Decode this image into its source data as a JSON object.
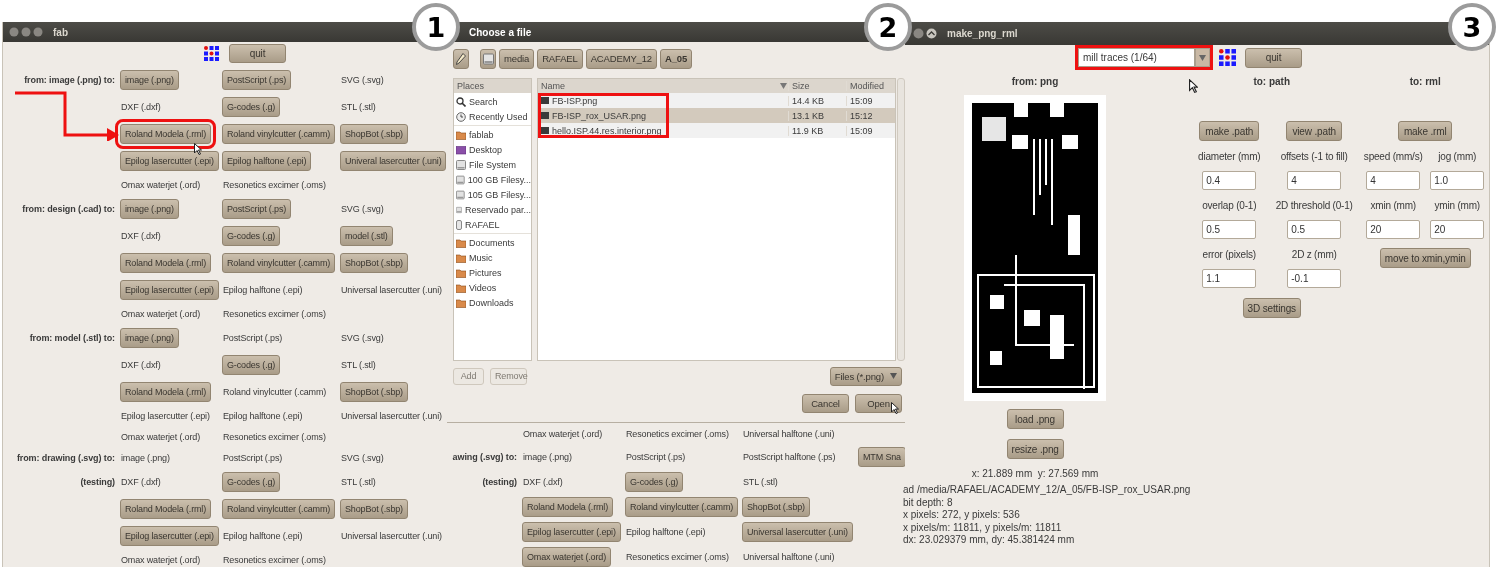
{
  "badges": [
    "1",
    "2",
    "3"
  ],
  "fab_window": {
    "title": "fab",
    "quit": "quit",
    "rows": [
      {
        "label": "from: image (.png) to:",
        "cells": [
          {
            "text": "image (.png)",
            "kind": "button"
          },
          {
            "text": "PostScript (.ps)",
            "kind": "button"
          },
          {
            "text": "SVG (.svg)",
            "kind": "label"
          }
        ]
      },
      {
        "cells": [
          {
            "text": "DXF (.dxf)",
            "kind": "label"
          },
          {
            "text": "G-codes (.g)",
            "kind": "button"
          },
          {
            "text": "STL (.stl)",
            "kind": "label"
          }
        ]
      },
      {
        "cells": [
          {
            "text": "Roland Modela (.rml)",
            "kind": "button",
            "highlighted": true
          },
          {
            "text": "Roland vinylcutter (.camm)",
            "kind": "button"
          },
          {
            "text": "ShopBot (.sbp)",
            "kind": "button"
          }
        ]
      },
      {
        "cells": [
          {
            "text": "Epilog lasercutter (.epi)",
            "kind": "button"
          },
          {
            "text": "Epilog halftone (.epi)",
            "kind": "button"
          },
          {
            "text": "Univeral lasercutter (.uni)",
            "kind": "button"
          }
        ]
      },
      {
        "cells": [
          {
            "text": "Omax waterjet (.ord)",
            "kind": "label"
          },
          {
            "text": "Resonetics excimer (.oms)",
            "kind": "label"
          }
        ]
      },
      {
        "label": "from: design (.cad) to:",
        "cells": [
          {
            "text": "image (.png)",
            "kind": "button"
          },
          {
            "text": "PostScript (.ps)",
            "kind": "button"
          },
          {
            "text": "SVG (.svg)",
            "kind": "label"
          }
        ]
      },
      {
        "cells": [
          {
            "text": "DXF (.dxf)",
            "kind": "label"
          },
          {
            "text": "G-codes (.g)",
            "kind": "button"
          },
          {
            "text": "model (.stl)",
            "kind": "button"
          }
        ]
      },
      {
        "cells": [
          {
            "text": "Roland Modela (.rml)",
            "kind": "button"
          },
          {
            "text": "Roland vinylcutter (.camm)",
            "kind": "button"
          },
          {
            "text": "ShopBot (.sbp)",
            "kind": "button"
          }
        ]
      },
      {
        "cells": [
          {
            "text": "Epilog lasercutter (.epi)",
            "kind": "button"
          },
          {
            "text": "Epilog halftone (.epi)",
            "kind": "label"
          },
          {
            "text": "Universal lasercutter (.uni)",
            "kind": "label"
          }
        ]
      },
      {
        "cells": [
          {
            "text": "Omax waterjet (.ord)",
            "kind": "label"
          },
          {
            "text": "Resonetics excimer (.oms)",
            "kind": "label"
          }
        ]
      },
      {
        "label": "from: model (.stl) to:",
        "cells": [
          {
            "text": "image (.png)",
            "kind": "button"
          },
          {
            "text": "PostScript (.ps)",
            "kind": "label"
          },
          {
            "text": "SVG (.svg)",
            "kind": "label"
          }
        ]
      },
      {
        "cells": [
          {
            "text": "DXF (.dxf)",
            "kind": "label"
          },
          {
            "text": "G-codes (.g)",
            "kind": "button"
          },
          {
            "text": "STL (.stl)",
            "kind": "label"
          }
        ]
      },
      {
        "cells": [
          {
            "text": "Roland Modela (.rml)",
            "kind": "button"
          },
          {
            "text": "Roland vinylcutter (.camm)",
            "kind": "label"
          },
          {
            "text": "ShopBot (.sbp)",
            "kind": "button"
          }
        ]
      },
      {
        "cells": [
          {
            "text": "Epilog lasercutter (.epi)",
            "kind": "label"
          },
          {
            "text": "Epilog halftone (.epi)",
            "kind": "label"
          },
          {
            "text": "Universal lasercutter (.uni)",
            "kind": "label"
          }
        ]
      },
      {
        "cells": [
          {
            "text": "Omax waterjet (.ord)",
            "kind": "label"
          },
          {
            "text": "Resonetics excimer (.oms)",
            "kind": "label"
          }
        ]
      },
      {
        "label": "from: drawing (.svg) to:",
        "cells": [
          {
            "text": "image (.png)",
            "kind": "label"
          },
          {
            "text": "PostScript (.ps)",
            "kind": "label"
          },
          {
            "text": "SVG (.svg)",
            "kind": "label"
          }
        ]
      },
      {
        "label": "(testing)",
        "cells": [
          {
            "text": "DXF (.dxf)",
            "kind": "label"
          },
          {
            "text": "G-codes (.g)",
            "kind": "button"
          },
          {
            "text": "STL (.stl)",
            "kind": "label"
          }
        ]
      },
      {
        "cells": [
          {
            "text": "Roland Modela (.rml)",
            "kind": "button"
          },
          {
            "text": "Roland vinylcutter (.camm)",
            "kind": "button"
          },
          {
            "text": "ShopBot (.sbp)",
            "kind": "button"
          }
        ]
      },
      {
        "cells": [
          {
            "text": "Epilog lasercutter (.epi)",
            "kind": "button"
          },
          {
            "text": "Epilog halftone (.epi)",
            "kind": "label"
          },
          {
            "text": "Universal lasercutter (.uni)",
            "kind": "label"
          }
        ]
      },
      {
        "cells": [
          {
            "text": "Omax waterjet (.ord)",
            "kind": "label"
          },
          {
            "text": "Resonetics excimer (.oms)",
            "kind": "label"
          }
        ]
      }
    ]
  },
  "file_dialog": {
    "title": "Choose a file",
    "path": [
      {
        "text": "media",
        "selected": false
      },
      {
        "text": "RAFAEL",
        "selected": false
      },
      {
        "text": "ACADEMY_12",
        "selected": false
      },
      {
        "text": "A_05",
        "selected": true
      }
    ],
    "places_header": "Places",
    "places": [
      {
        "items": [
          {
            "text": "Search",
            "kind": "search"
          },
          {
            "text": "Recently Used",
            "kind": "recent"
          }
        ]
      },
      {
        "items": [
          {
            "text": "fablab",
            "kind": "folder"
          },
          {
            "text": "Desktop",
            "kind": "desktop"
          },
          {
            "text": "File System",
            "kind": "drive"
          },
          {
            "text": "100 GB Filesy...",
            "kind": "drive"
          },
          {
            "text": "105 GB Filesy...",
            "kind": "drive"
          },
          {
            "text": "Reservado par...",
            "kind": "drive"
          },
          {
            "text": "RAFAEL",
            "kind": "usb"
          }
        ]
      },
      {
        "items": [
          {
            "text": "Documents",
            "kind": "folder"
          },
          {
            "text": "Music",
            "kind": "folder"
          },
          {
            "text": "Pictures",
            "kind": "folder"
          },
          {
            "text": "Videos",
            "kind": "folder"
          },
          {
            "text": "Downloads",
            "kind": "folder"
          }
        ]
      }
    ],
    "columns": [
      "Name",
      "Size",
      "Modified"
    ],
    "files_highlighted": true,
    "files": [
      {
        "name": "FB-ISP.png",
        "size": "14.4 KB",
        "modified": "15:09",
        "selected": false
      },
      {
        "name": "FB-ISP_rox_USAR.png",
        "size": "13.1 KB",
        "modified": "15:12",
        "selected": true
      },
      {
        "name": "hello.ISP.44.res.interior.png",
        "size": "11.9 KB",
        "modified": "15:09",
        "selected": false
      }
    ],
    "place_buttons": [
      {
        "text": "Add",
        "disabled": true
      },
      {
        "text": "Remove",
        "disabled": true
      }
    ],
    "filter": "Files (*.png)",
    "buttons": [
      "Cancel",
      "Open"
    ]
  },
  "fab_window_behind": {
    "rows": [
      {
        "cells": [
          {
            "text": "Omax waterjet (.ord)",
            "kind": "label"
          },
          {
            "text": "Resonetics excimer (.oms)",
            "kind": "label"
          },
          {
            "text": "Universal halftone (.uni)",
            "kind": "label"
          }
        ]
      },
      {
        "label": "awing (.svg) to:",
        "cells": [
          {
            "text": "image (.png)",
            "kind": "label"
          },
          {
            "text": "PostScript (.ps)",
            "kind": "label"
          },
          {
            "text": "PostScript halftone (.ps)",
            "kind": "label"
          },
          {
            "text": "MTM Sna",
            "kind": "button"
          }
        ]
      },
      {
        "label": "(testing)",
        "cells": [
          {
            "text": "DXF (.dxf)",
            "kind": "label"
          },
          {
            "text": "G-codes (.g)",
            "kind": "button"
          },
          {
            "text": "STL (.stl)",
            "kind": "label"
          }
        ]
      },
      {
        "cells": [
          {
            "text": "Roland Modela (.rml)",
            "kind": "button"
          },
          {
            "text": "Roland vinylcutter (.camm)",
            "kind": "button"
          },
          {
            "text": "ShopBot (.sbp)",
            "kind": "button"
          }
        ]
      },
      {
        "cells": [
          {
            "text": "Epilog lasercutter (.epi)",
            "kind": "button"
          },
          {
            "text": "Epilog halftone (.epi)",
            "kind": "label"
          },
          {
            "text": "Universal lasercutter (.uni)",
            "kind": "button"
          }
        ]
      },
      {
        "cells": [
          {
            "text": "Omax waterjet (.ord)",
            "kind": "button"
          },
          {
            "text": "Resonetics excimer (.oms)",
            "kind": "label"
          },
          {
            "text": "Universal halftone (.uni)",
            "kind": "label"
          }
        ]
      }
    ]
  },
  "make_png_rml": {
    "title": "make_png_rml",
    "mode": {
      "value": "mill traces (1/64)",
      "highlighted": true
    },
    "quit": "quit",
    "png": {
      "header": "from: png",
      "image": {
        "kind": "picture"
      },
      "buttons": [
        "load .png",
        "resize .png"
      ],
      "size": "x: 21.889 mm  y: 27.569 mm",
      "info": [
        "ad /media/RAFAEL/ACADEMY_12/A_05/FB-ISP_rox_USAR.png",
        "bit depth: 8",
        "x pixels: 272, y pixels: 536",
        "x pixels/m: 11811, y pixels/m: 11811",
        "dx: 23.029379 mm, dy: 45.381424 mm"
      ]
    },
    "path": {
      "header": "to: path",
      "buttons": [
        "make .path",
        "view .path"
      ],
      "fields": [
        {
          "label": "diameter (mm)",
          "value": "0.4"
        },
        {
          "label": "offsets (-1 to fill)",
          "value": "4"
        },
        {
          "label": "overlap (0-1)",
          "value": "0.5"
        },
        {
          "label": "2D threshold (0-1)",
          "value": "0.5"
        },
        {
          "label": "error (pixels)",
          "value": "1.1"
        },
        {
          "label": "2D z (mm)",
          "value": "-0.1"
        }
      ],
      "settings": "3D settings"
    },
    "rml": {
      "header": "to: rml",
      "button": "make .rml",
      "fields": [
        {
          "label": "speed (mm/s)",
          "value": "4"
        },
        {
          "label": "jog (mm)",
          "value": "1.0"
        },
        {
          "label": "xmin (mm)",
          "value": "20"
        },
        {
          "label": "ymin (mm)",
          "value": "20"
        }
      ],
      "move": "move to xmin,ymin"
    }
  }
}
